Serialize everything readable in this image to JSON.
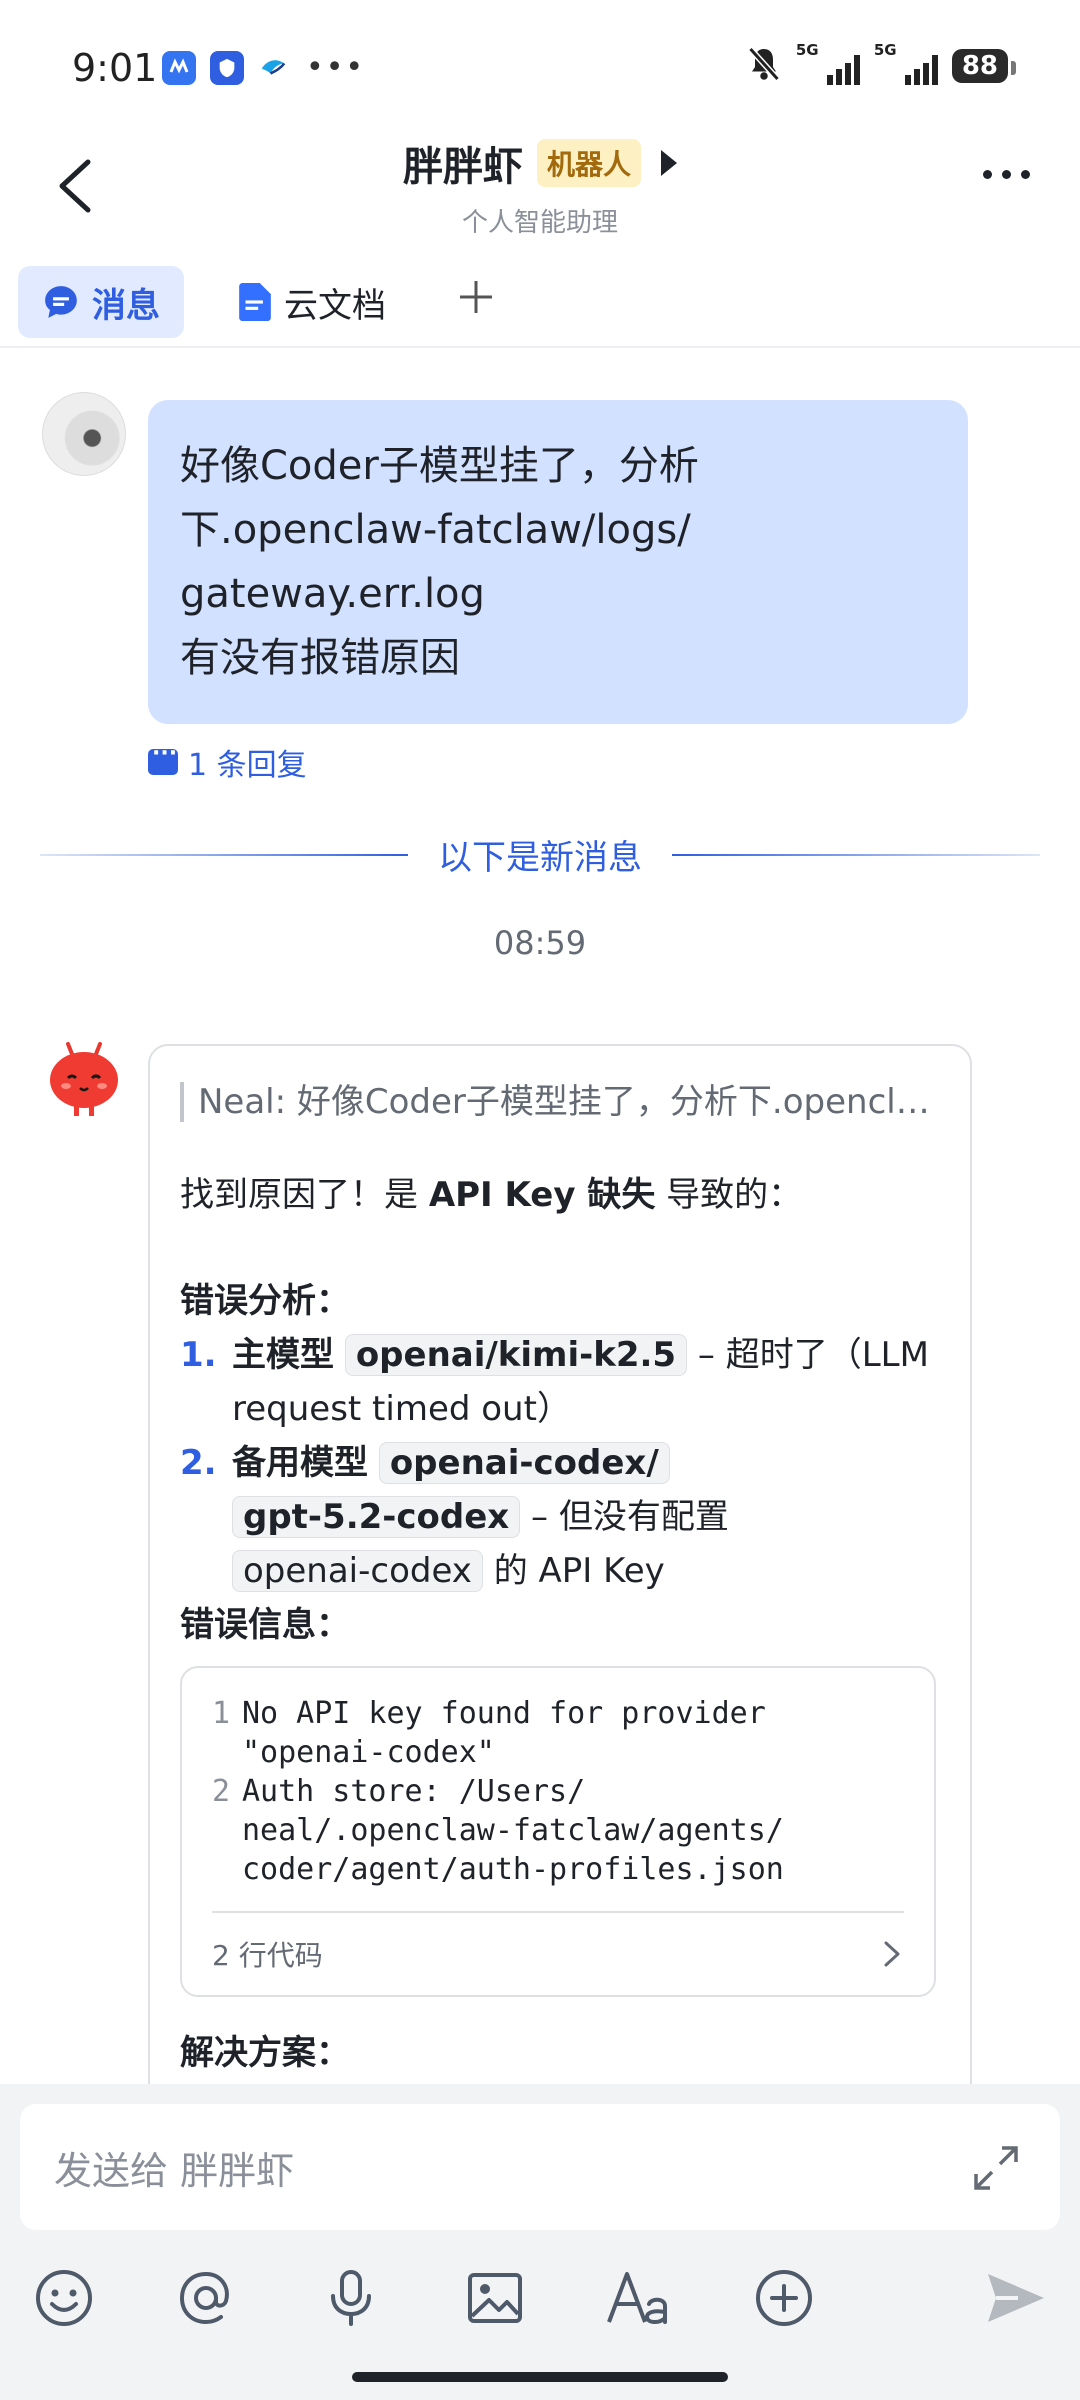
{
  "status_bar": {
    "time": "9:01",
    "net1": "5G",
    "net2": "5G",
    "battery": "88"
  },
  "header": {
    "title": "胖胖虾",
    "badge": "机器人",
    "subtitle": "个人智能助理"
  },
  "tabs": [
    {
      "label": "消息",
      "active": true
    },
    {
      "label": "云文档",
      "active": false
    }
  ],
  "user_message": {
    "lines": [
      "好像Coder子模型挂了，分析",
      "下.openclaw-fatclaw/logs/",
      "gateway.err.log",
      "有没有报错原因"
    ],
    "reply_count": "1 条回复"
  },
  "divider": {
    "label": "以下是新消息"
  },
  "timestamp": "08:59",
  "bot_message": {
    "quote": "Neal: 好像Coder子模型挂了，分析下.openclaw-fatclaw/logs/gateway.err.log 有没有报错原因",
    "intro_prefix": "找到原因了！是 ",
    "intro_bold": "API Key 缺失",
    "intro_suffix": " 导致的：",
    "error_analysis_heading": "错误分析：",
    "items": [
      {
        "num": "1.",
        "label": "主模型",
        "code": "openai/kimi-k2.5",
        "text_line1": " – 超时了（LLM",
        "text_line2": "request timed out）"
      },
      {
        "num": "2.",
        "label": "备用模型",
        "code_line1": "openai-codex/",
        "code_line2": "gpt-5.2-codex",
        "text1": " – 但没有配置",
        "code2": "openai-codex",
        "text2": " 的 API Key"
      }
    ],
    "error_info_heading": "错误信息：",
    "code_block": {
      "lines": [
        {
          "n": "1",
          "text": [
            "No API key found for provider",
            "\"openai-codex\""
          ]
        },
        {
          "n": "2",
          "text": [
            "Auth store: /Users/",
            "neal/.openclaw-fatclaw/agents/",
            "coder/agent/auth-profiles.json"
          ]
        }
      ],
      "footer": "2 行代码"
    },
    "next_heading": "解决方案："
  },
  "composer": {
    "placeholder": "发送给 胖胖虾"
  },
  "colors": {
    "accent": "#2f5fe0",
    "user_bubble": "#d1e1ff",
    "badge_bg": "#fdf0c3"
  }
}
